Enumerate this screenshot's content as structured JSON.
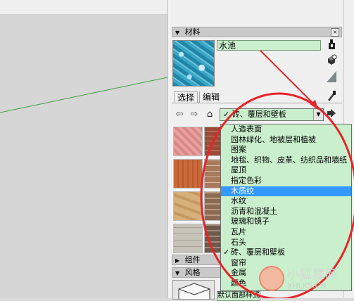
{
  "materials_panel": {
    "title": "材料",
    "close_label": "×",
    "material_name": "水池",
    "tabs": [
      {
        "label": "选择"
      },
      {
        "label": "编辑"
      }
    ],
    "library_selected": "砖、覆层和壁板",
    "library_options": [
      {
        "label": "人造表面",
        "selected": false,
        "checked": false
      },
      {
        "label": "园林绿化、地被层和植被",
        "selected": false,
        "checked": false
      },
      {
        "label": "图案",
        "selected": false,
        "checked": false
      },
      {
        "label": "地毯、织物、皮革、纺织品和墙纸",
        "selected": false,
        "checked": false
      },
      {
        "label": "屋顶",
        "selected": false,
        "checked": false
      },
      {
        "label": "指定色彩",
        "selected": false,
        "checked": false
      },
      {
        "label": "木质纹",
        "selected": true,
        "checked": false
      },
      {
        "label": "水纹",
        "selected": false,
        "checked": false
      },
      {
        "label": "沥青和混凝土",
        "selected": false,
        "checked": false
      },
      {
        "label": "玻璃和镜子",
        "selected": false,
        "checked": false
      },
      {
        "label": "瓦片",
        "selected": false,
        "checked": false
      },
      {
        "label": "石头",
        "selected": false,
        "checked": false
      },
      {
        "label": "砖、覆层和壁板",
        "selected": false,
        "checked": true
      },
      {
        "label": "窗帘",
        "selected": false,
        "checked": false
      },
      {
        "label": "金属",
        "selected": false,
        "checked": false
      },
      {
        "label": "颜色",
        "selected": false,
        "checked": false
      }
    ],
    "thumbnails": [
      {
        "color": "#e8a2a0"
      },
      {
        "color": "#9a4a35"
      },
      {
        "color": "#c96a3a"
      },
      {
        "color": "#a87a5a"
      },
      {
        "color": "#d6b07a"
      },
      {
        "color": "#8b6a52"
      },
      {
        "color": "#c8c3b8"
      },
      {
        "color": "#6d5a4a"
      }
    ],
    "check_mark": "✓"
  },
  "components_panel": {
    "title": "组件"
  },
  "styles_panel": {
    "title": "风格",
    "field_text": "默认面部样式"
  },
  "watermark": {
    "title": "小狐狸网",
    "url": "XHLKS.CN"
  },
  "colors": {
    "field_green": "#c9efcc",
    "highlight_blue": "#3399ff",
    "annotation_red": "#e8232a"
  }
}
